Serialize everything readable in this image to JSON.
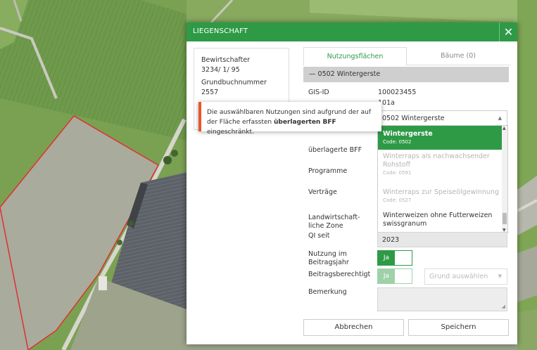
{
  "dialog": {
    "title": "LIEGENSCHAFT",
    "close_symbol": "✕"
  },
  "info": {
    "bewirtschafter_label": "Bewirtschafter",
    "bewirtschafter_value": "3234/ 1/ 95",
    "grundbuch_label": "Grundbuchnummer",
    "grundbuch_value": "2557"
  },
  "tabs": [
    {
      "label": "Nutzungsflächen",
      "active": true
    },
    {
      "label": "Bäume (0)",
      "active": false
    }
  ],
  "section": {
    "collapse_symbol": "—",
    "title": "0502 Wintergerste"
  },
  "fields": {
    "gis_id_label": "GIS-ID",
    "gis_id_value": "100023455",
    "code_value": "101a",
    "ueberlagerte_bff_label": "überlagerte BFF",
    "programme_label": "Programme",
    "vertraege_label": "Verträge",
    "zone_label_1": "Landwirtschaft-",
    "zone_label_2": "liche Zone",
    "qi_label": "QI seit",
    "qi_value": "2023",
    "nutzung_label_1": "Nutzung im",
    "nutzung_label_2": "Beitragsjahr",
    "nutzung_toggle": "Ja",
    "beitrag_label": "Beitragsberechtigt",
    "beitrag_toggle": "Ja",
    "grund_placeholder": "Grund auswählen",
    "bemerkung_label": "Bemerkung"
  },
  "select": {
    "value": "0502 Wintergerste",
    "options": [
      {
        "name": "Wintergerste",
        "code": "Code: 0502",
        "state": "selected"
      },
      {
        "name": "Winterraps als nachwachsender",
        "name2": "Rohstoff",
        "code": "Code: 0591",
        "state": "disabled"
      },
      {
        "name": "Winterraps zur Speiseölgewinnung",
        "code": "Code: 0527",
        "state": "disabled"
      },
      {
        "name": "Winterweizen ohne Futterweizen",
        "name2": "swissgranum",
        "state": "normal"
      }
    ]
  },
  "tooltip": {
    "line1": "Die auswählbaren Nutzungen sind aufgrund der auf",
    "line2_pre": "der Fläche erfassten ",
    "line2_bold": "überlagerten BFF",
    "line2_post": " eingeschränkt."
  },
  "buttons": {
    "cancel": "Abbrechen",
    "save": "Speichern"
  },
  "colors": {
    "brand_green": "#2e9a46",
    "warning_orange": "#e8562a",
    "parcel_outline": "#e03030"
  }
}
